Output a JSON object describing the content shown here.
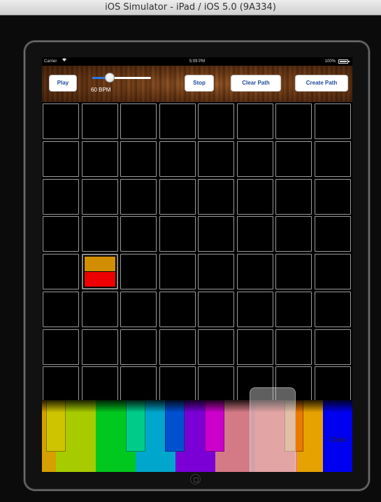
{
  "window": {
    "title": "iOS Simulator - iPad / iOS 5.0 (9A334)"
  },
  "status_bar": {
    "carrier": "Carrier",
    "time": "5:09 PM",
    "battery": "100%"
  },
  "toolbar": {
    "play_label": "Play",
    "stop_label": "Stop",
    "clear_path_label": "Clear Path",
    "create_path_label": "Create Path",
    "tempo": {
      "label": "60 BPM",
      "slider_value": 0.3
    }
  },
  "grid": {
    "rows": 8,
    "cols": 8,
    "active_cells": [
      {
        "row": 5,
        "col": 2,
        "top_color": "#d18f00",
        "bottom_color": "#ee0000"
      }
    ]
  },
  "keyboard": {
    "white_keys": [
      {
        "color": "#d6a000",
        "label": ""
      },
      {
        "color": "#a6cc00",
        "label": ""
      },
      {
        "color": "#00c81e",
        "label": ""
      },
      {
        "color": "#00a6cc",
        "label": ""
      },
      {
        "color": "#7a00d6",
        "label": ""
      },
      {
        "color": "#d47a86",
        "label": ""
      },
      {
        "color": "#f07e7e",
        "label": ""
      },
      {
        "color": "#e6a200",
        "label": ""
      },
      {
        "color": "#0000f0",
        "label": "Clear"
      }
    ],
    "black_keys": [
      {
        "color": "#cfc400"
      },
      {
        "color": "#00cc8a"
      },
      {
        "color": "#0050d0"
      },
      {
        "color": "#cc00cc"
      },
      {
        "color": "#f0b080"
      },
      {
        "color": "#ea7a00"
      }
    ],
    "highlighted_key_index": 6
  }
}
